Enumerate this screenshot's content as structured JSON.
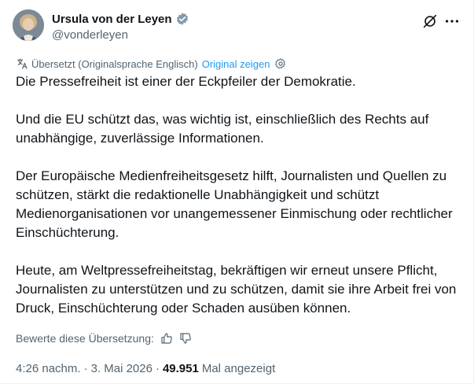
{
  "author": {
    "display_name": "Ursula von der Leyen",
    "handle": "@vonderleyen",
    "verified_color": "#829aab"
  },
  "translation": {
    "notice": "Übersetzt (Originalsprache Englisch)",
    "show_original": "Original zeigen"
  },
  "tweet": {
    "paragraphs": [
      "Die Pressefreiheit ist einer der Eckpfeiler der Demokratie.",
      "Und die EU schützt das, was wichtig ist, einschließlich des Rechts auf unabhängige, zuverlässige Informationen.",
      "Der Europäische Medienfreiheitsgesetz hilft, Journalisten und Quellen zu schützen, stärkt die redaktionelle Unabhängigkeit und schützt Medienorganisationen vor unangemessener Einmischung oder rechtlicher Einschüchterung.",
      "Heute, am Weltpressefreiheitstag, bekräftigen wir erneut unsere Pflicht, Journalisten zu unterstützen und zu schützen, damit sie ihre Arbeit frei von Druck, Einschüchterung oder Schaden ausüben können."
    ]
  },
  "rating": {
    "label": "Bewerte diese Übersetzung:"
  },
  "meta": {
    "time": "4:26 nachm.",
    "separator": "·",
    "date": "3. Mai 2026",
    "views_count": "49.951",
    "views_label": "Mal angezeigt"
  },
  "icons": {
    "verified": "verified-badge-icon",
    "grok": "grok-icon",
    "more": "more-icon",
    "globe": "translate-icon",
    "gear": "gear-icon",
    "thumbs_up": "thumbs-up-icon",
    "thumbs_down": "thumbs-down-icon"
  },
  "colors": {
    "link": "#1d9bf0",
    "secondary_text": "#536471",
    "primary_text": "#0f1419"
  }
}
